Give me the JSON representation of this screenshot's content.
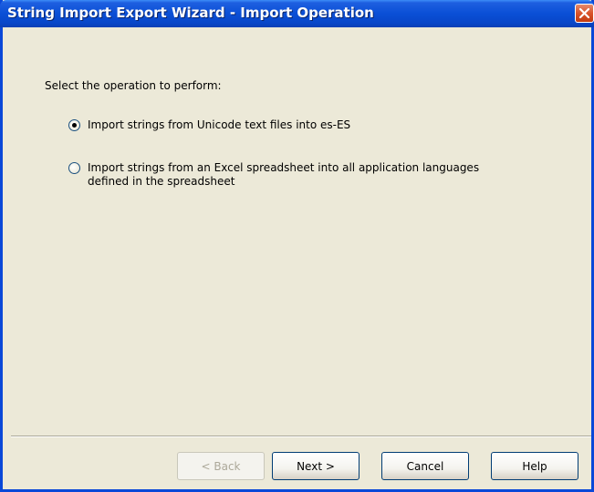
{
  "window": {
    "title": "String Import Export Wizard - Import Operation"
  },
  "main": {
    "instruction": "Select the operation to perform:",
    "options": [
      {
        "label": "Import strings from Unicode text files into es-ES",
        "selected": true
      },
      {
        "label_line1": "Import strings from an Excel spreadsheet into all application languages",
        "label_line2": "defined in the spreadsheet",
        "selected": false
      }
    ]
  },
  "buttons": {
    "back": "< Back",
    "next": "Next >",
    "cancel": "Cancel",
    "help": "Help"
  },
  "colors": {
    "titlebar": "#0a4fd6",
    "window_bg": "#ece9d8",
    "close_button": "#d9532a"
  }
}
